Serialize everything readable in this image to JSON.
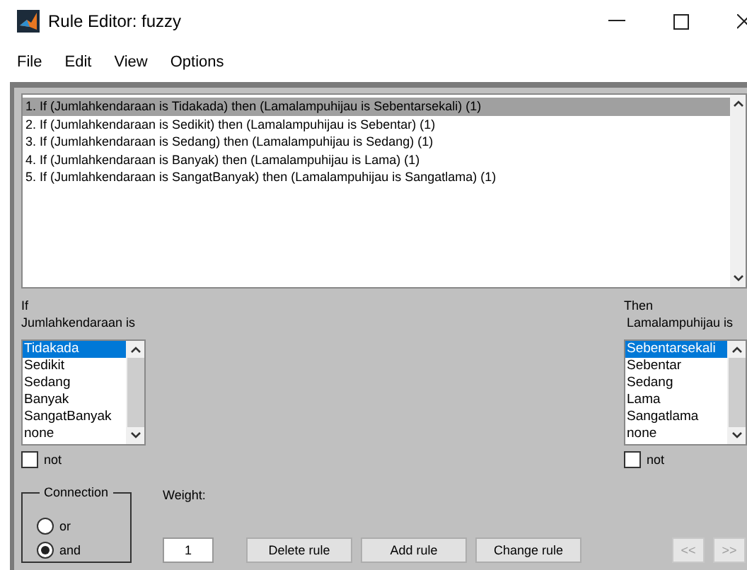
{
  "window": {
    "title": "Rule Editor: fuzzy"
  },
  "menu": [
    "File",
    "Edit",
    "View",
    "Options"
  ],
  "rules": [
    {
      "text": "1. If (Jumlahkendaraan is Tidakada) then (Lamalampuhijau is Sebentarsekali) (1)",
      "selected": true
    },
    {
      "text": "2. If (Jumlahkendaraan is Sedikit) then (Lamalampuhijau is Sebentar) (1)",
      "selected": false
    },
    {
      "text": "3. If (Jumlahkendaraan is Sedang) then (Lamalampuhijau is Sedang) (1)",
      "selected": false
    },
    {
      "text": "4. If (Jumlahkendaraan is Banyak) then (Lamalampuhijau is Lama) (1)",
      "selected": false
    },
    {
      "text": "5. If (Jumlahkendaraan is SangatBanyak) then (Lamalampuhijau is Sangatlama) (1)",
      "selected": false
    }
  ],
  "input": {
    "heading": "If",
    "variable": "Jumlahkendaraan is",
    "options": [
      {
        "label": "Tidakada",
        "selected": true
      },
      {
        "label": "Sedikit",
        "selected": false
      },
      {
        "label": "Sedang",
        "selected": false
      },
      {
        "label": "Banyak",
        "selected": false
      },
      {
        "label": "SangatBanyak",
        "selected": false
      },
      {
        "label": "none",
        "selected": false
      }
    ],
    "not_label": "not",
    "not_checked": false
  },
  "output": {
    "heading": "Then",
    "variable": "Lamalampuhijau is",
    "options": [
      {
        "label": "Sebentarsekali",
        "selected": true
      },
      {
        "label": "Sebentar",
        "selected": false
      },
      {
        "label": "Sedang",
        "selected": false
      },
      {
        "label": "Lama",
        "selected": false
      },
      {
        "label": "Sangatlama",
        "selected": false
      },
      {
        "label": "none",
        "selected": false
      }
    ],
    "not_label": "not",
    "not_checked": false
  },
  "connection": {
    "title": "Connection",
    "options": [
      {
        "label": "or",
        "selected": false
      },
      {
        "label": "and",
        "selected": true
      }
    ]
  },
  "weight": {
    "label": "Weight:",
    "value": "1"
  },
  "buttons": [
    "Delete rule",
    "Add rule",
    "Change rule"
  ],
  "nav": [
    {
      "label": "<<",
      "disabled": true
    },
    {
      "label": ">>",
      "disabled": true
    }
  ]
}
